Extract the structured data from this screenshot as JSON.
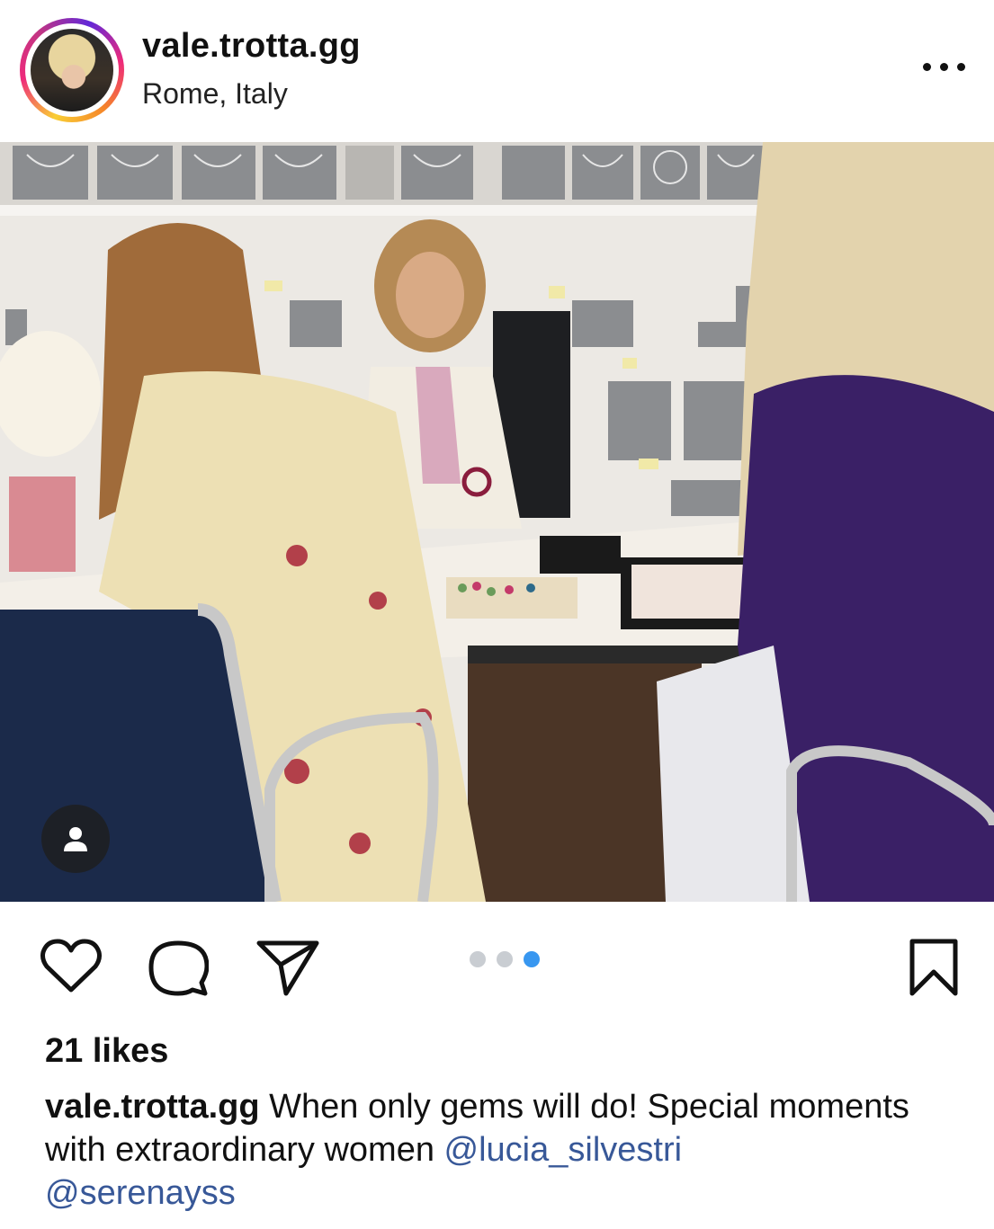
{
  "post": {
    "username": "vale.trotta.gg",
    "location": "Rome, Italy",
    "likes": "21 likes",
    "caption_user": "vale.trotta.gg",
    "caption_text": " When only gems will do! Special moments with extraordinary women ",
    "mentions": [
      "@lucia_silvestri",
      "@serenayss"
    ]
  },
  "carousel": {
    "total": 3,
    "active_index": 3
  },
  "icons": {
    "more": "more-options-icon",
    "like": "heart-icon",
    "comment": "comment-bubble-icon",
    "share": "paper-plane-icon",
    "save": "bookmark-icon",
    "tag": "person-tag-icon"
  },
  "colors": {
    "mention": "#385898",
    "active_dot": "#3897f0",
    "inactive_dot": "#c9cdd2"
  }
}
